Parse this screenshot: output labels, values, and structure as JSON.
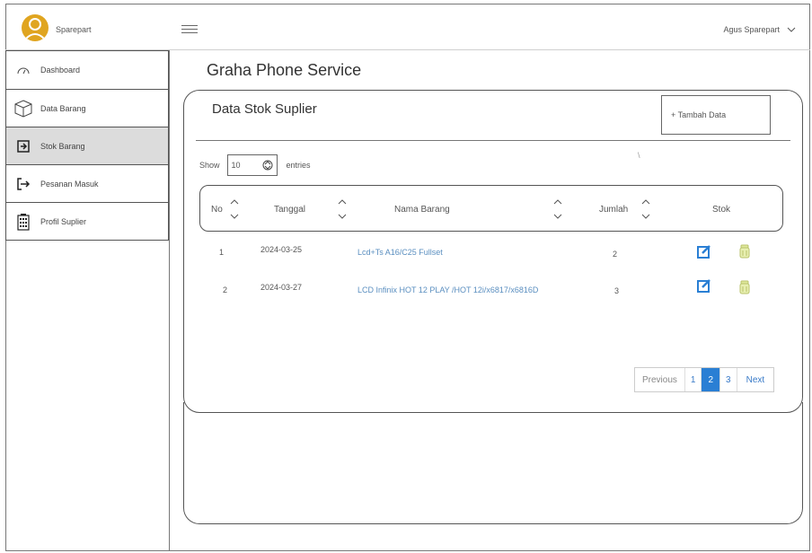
{
  "app": {
    "name": "Sparepart",
    "user": "Agus Sparepart"
  },
  "sidebar": {
    "items": [
      {
        "label": "Dashboard",
        "icon": "dashboard-gauge-icon"
      },
      {
        "label": "Data Barang",
        "icon": "box-icon"
      },
      {
        "label": "Stok Barang",
        "icon": "login-arrow-icon"
      },
      {
        "label": "Pesanan Masuk",
        "icon": "arrow-in-icon"
      },
      {
        "label": "Profil Suplier",
        "icon": "building-icon"
      }
    ],
    "active_index": 2
  },
  "page": {
    "title": "Graha Phone Service"
  },
  "card": {
    "title": "Data Stok Suplier",
    "add_label": "+ Tambah Data",
    "tick_mark": "\\"
  },
  "table_controls": {
    "show_label": "Show",
    "entries_value": "10",
    "entries_label": "entries"
  },
  "table": {
    "columns": [
      "No",
      "Tanggal",
      "Nama Barang",
      "Jumlah",
      "Stok"
    ],
    "rows": [
      {
        "no": "1",
        "tanggal": "2024-03-25",
        "nama": "Lcd+Ts A16/C25 Fullset",
        "jumlah": "2"
      },
      {
        "no": "2",
        "tanggal": "2024-03-27",
        "nama": "LCD Infinix HOT 12 PLAY /HOT 12i/x6817/x6816D",
        "jumlah": "3"
      }
    ]
  },
  "pagination": {
    "previous": "Previous",
    "pages": [
      "1",
      "2",
      "3"
    ],
    "current": "2",
    "next": "Next"
  },
  "colors": {
    "accent": "#2a7fd4",
    "avatar": "#e0a520",
    "link": "#5b8fc0",
    "active_side": "#dcdcdc"
  }
}
